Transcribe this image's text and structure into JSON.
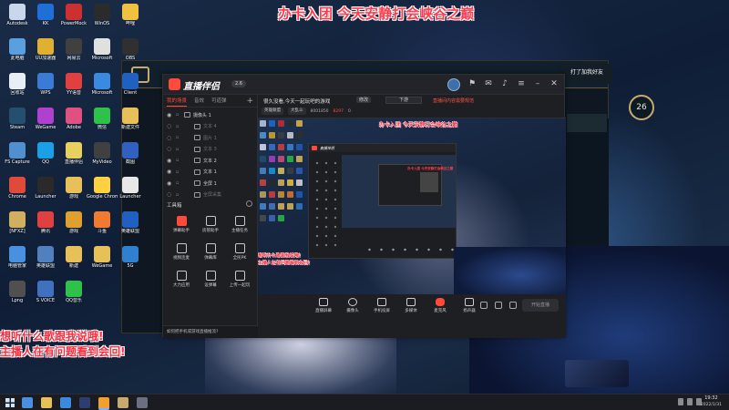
{
  "overlay": {
    "top_banner": "办卡入团 今天安静打会峡谷之巅",
    "bottom_line1": "想听什么歌跟我说哦!",
    "bottom_line2": "主播人在有问题看到会回!"
  },
  "desktop_icons": [
    {
      "label": "Autodesk",
      "color": "#c9d7ec"
    },
    {
      "label": "KK",
      "color": "#1f6fd8"
    },
    {
      "label": "PowerMock",
      "color": "#cc3030"
    },
    {
      "label": "WinOS",
      "color": "#2b2b2b"
    },
    {
      "label": "哔哩",
      "color": "#f0c040"
    },
    {
      "label": "此电脑",
      "color": "#5aa0e0"
    },
    {
      "label": "UU加速器",
      "color": "#e0b030"
    },
    {
      "label": "网易云",
      "color": "#404040"
    },
    {
      "label": "Microsoft",
      "color": "#e0e0e0"
    },
    {
      "label": "OBS",
      "color": "#303030"
    },
    {
      "label": "回收站",
      "color": "#e8eef6"
    },
    {
      "label": "WPS",
      "color": "#3a7bd5"
    },
    {
      "label": "YY语音",
      "color": "#e04040"
    },
    {
      "label": "Microsoft",
      "color": "#3c8ae0"
    },
    {
      "label": "Client",
      "color": "#2060c0"
    },
    {
      "label": "Steam",
      "color": "#24506e"
    },
    {
      "label": "WeGame",
      "color": "#b040d0"
    },
    {
      "label": "Adobe",
      "color": "#e05080"
    },
    {
      "label": "微信",
      "color": "#2ec24a"
    },
    {
      "label": "新建文件",
      "color": "#e8c05a"
    },
    {
      "label": "FS Capture",
      "color": "#5090d0"
    },
    {
      "label": "QQ",
      "color": "#1aa0e6"
    },
    {
      "label": "直播伴侣",
      "color": "#e8d060"
    },
    {
      "label": "MyVideo",
      "color": "#404040"
    },
    {
      "label": "截图",
      "color": "#3060c0"
    },
    {
      "label": "Chrome",
      "color": "#e04a3a"
    },
    {
      "label": "Launcher",
      "color": "#2a2a2a"
    },
    {
      "label": "游戏",
      "color": "#e8c05a"
    },
    {
      "label": "Google Chrome",
      "color": "#ffd040"
    },
    {
      "label": "Launcher",
      "color": "#e8e8e8"
    },
    {
      "label": "[NFXZ]",
      "color": "#d0b060"
    },
    {
      "label": "腾讯",
      "color": "#e04040"
    },
    {
      "label": "游戏",
      "color": "#e0a030"
    },
    {
      "label": "斗鱼",
      "color": "#f07a30"
    },
    {
      "label": "英雄联盟",
      "color": "#2060c0"
    },
    {
      "label": "电脑管家",
      "color": "#4a90e0"
    },
    {
      "label": "英雄联盟",
      "color": "#5080c0"
    },
    {
      "label": "新建",
      "color": "#e8c05a"
    },
    {
      "label": "WeGame",
      "color": "#e8c05a"
    },
    {
      "label": "5G",
      "color": "#3080d0"
    },
    {
      "label": "Lpng",
      "color": "#505050"
    },
    {
      "label": "S VOICE",
      "color": "#4070c0"
    },
    {
      "label": "QQ音乐",
      "color": "#2ec24a"
    }
  ],
  "lol": {
    "level": "26",
    "rp_text": "50",
    "topright_text": "打了加我好友"
  },
  "app": {
    "name": "直播伴侣",
    "version": "2.6",
    "tabs": [
      "我的场景",
      "音效",
      "可道弹"
    ],
    "scenes": [
      {
        "label": "摄像头 1",
        "visible": true,
        "indent": false
      },
      {
        "label": "文本 4",
        "visible": false,
        "indent": true
      },
      {
        "label": "图片 1",
        "visible": false,
        "indent": true
      },
      {
        "label": "文本 3",
        "visible": false,
        "indent": true
      },
      {
        "label": "文本 2",
        "visible": true,
        "indent": true
      },
      {
        "label": "文本 1",
        "visible": true,
        "indent": true
      },
      {
        "label": "全屏 1",
        "visible": true,
        "indent": true
      },
      {
        "label": "全屏采集",
        "visible": false,
        "indent": true
      }
    ],
    "tools_title": "工具箱",
    "tools": [
      "弹幕助手",
      "房管助手",
      "主播任务",
      "视频连麦",
      "弹幕库",
      "全民PK",
      "大力应用",
      "设弹幕",
      "上传一起玩"
    ],
    "tip": "如何把手机或游戏直播推流?",
    "room": {
      "title": "很久没看,今天一起玩吧的游戏",
      "edit": "修改",
      "select": "下游",
      "warn": "直播间内容需要规范",
      "tags": [
        "英雄联盟",
        "大乱斗"
      ],
      "stats": [
        "8001850",
        "8297",
        "0"
      ]
    },
    "preview": {
      "banner": "办卡入团 今天安静打会峡谷之巅",
      "msg1": "想听什么歌跟我说哦!",
      "msg2": "主播人在有问题看到会回!"
    },
    "bottom_tools": [
      "直播屏幕",
      "摄像头",
      "手机投屏",
      "多媒体",
      "麦克风",
      "扬声器"
    ],
    "start_btn": "开始直播"
  },
  "taskbar": {
    "time": "19:32",
    "date": "2022/1/31"
  },
  "colors": {
    "accent": "#ff4a3c",
    "lol_gold": "#c8aa6e"
  }
}
